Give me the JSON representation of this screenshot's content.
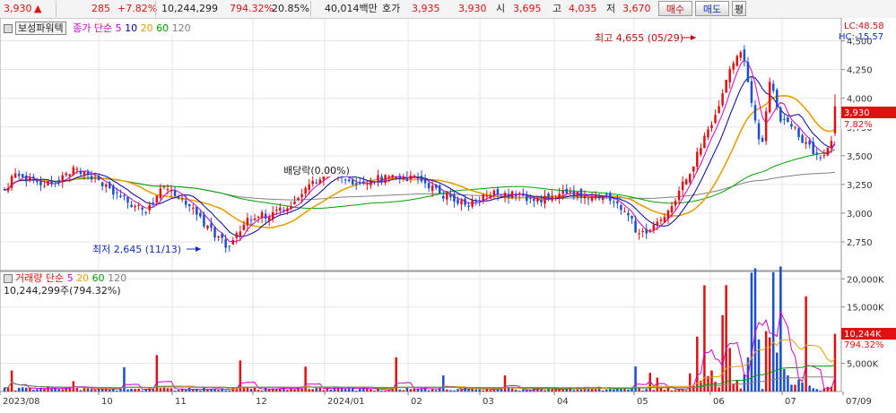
{
  "topbar": {
    "price": "3,930",
    "change_arrow": "▲",
    "change": "285",
    "change_pct": "+7.82%",
    "volume": "10,244,299",
    "volume_ratio": "794.32%",
    "turnover": "20.85%",
    "amount": "40,014백만",
    "quote_label": "호가",
    "ask": "3,935",
    "bid": "3,930",
    "open_label": "시",
    "open": "3,695",
    "high_label": "고",
    "high": "4,035",
    "low_label": "저",
    "low": "3,670",
    "buy_button": "매수",
    "sell_button": "매도",
    "eval_button": "평"
  },
  "price_panel": {
    "legend_name": "보성파워텍",
    "legend_ma_title": "종가 단순",
    "legend_ma_periods": [
      "5",
      "10",
      "20",
      "60",
      "120"
    ],
    "lc_label": "LC:48.58",
    "hc_label": "HC:-15.57",
    "high_annotation": "최고 4,655 (05/29)",
    "low_annotation": "최저 2,645 (11/13)",
    "dividend_annotation": "배당락(0.00%)",
    "last_price_tag": "3,930",
    "last_pct_tag": "7.82%"
  },
  "volume_panel": {
    "legend_title": "거래량 단순",
    "legend_ma_periods": [
      "5",
      "20",
      "60",
      "120"
    ],
    "current_value": "10,244,299주(794.32%)",
    "last_vol_tag": "10,244K",
    "last_pct_tag": "794.32%"
  },
  "colors": {
    "up": "#e01010",
    "down": "#1a4fd0",
    "ma5": "#d000d0",
    "ma10": "#0000a0",
    "ma20": "#e8a000",
    "ma60": "#00a000",
    "ma120": "#808080",
    "grid": "#e6e6e6"
  },
  "chart_data": {
    "type": "candlestick",
    "date_labels": [
      "2023/08",
      "10",
      "11",
      "12",
      "2024/01",
      "02",
      "03",
      "04",
      "05",
      "06",
      "07",
      "07/09"
    ],
    "price_axis": {
      "ylim": [
        2500,
        4700
      ],
      "ticks": [
        2750,
        3000,
        3250,
        3500,
        3750,
        4000,
        4250,
        4500
      ]
    },
    "volume_axis": {
      "ylim": [
        0,
        21000
      ],
      "ticks": [
        5000,
        10000,
        15000,
        20000
      ],
      "tick_labels": [
        "5,000K",
        "10,000K",
        "15,000K",
        "20,000K"
      ]
    },
    "extremes": {
      "high": 4655,
      "high_date": "05/29",
      "low": 2645,
      "low_date": "11/13"
    },
    "last": {
      "open": 3695,
      "high": 4035,
      "low": 3670,
      "close": 3930,
      "volume_k": 10244
    },
    "close_path": [
      [
        0,
        3190
      ],
      [
        5,
        3350
      ],
      [
        12,
        3280
      ],
      [
        20,
        3250
      ],
      [
        30,
        3380
      ],
      [
        40,
        3280
      ],
      [
        50,
        3150
      ],
      [
        60,
        3010
      ],
      [
        70,
        3250
      ],
      [
        80,
        3050
      ],
      [
        90,
        2830
      ],
      [
        97,
        2700
      ],
      [
        105,
        2950
      ],
      [
        115,
        3000
      ],
      [
        125,
        3100
      ],
      [
        135,
        3300
      ],
      [
        140,
        3400
      ],
      [
        150,
        3260
      ],
      [
        160,
        3300
      ],
      [
        170,
        3320
      ],
      [
        180,
        3290
      ],
      [
        190,
        3150
      ],
      [
        200,
        3070
      ],
      [
        210,
        3180
      ],
      [
        220,
        3160
      ],
      [
        230,
        3120
      ],
      [
        240,
        3170
      ],
      [
        250,
        3160
      ],
      [
        260,
        3150
      ],
      [
        268,
        3020
      ],
      [
        273,
        2820
      ],
      [
        280,
        2870
      ],
      [
        290,
        3150
      ],
      [
        300,
        3560
      ],
      [
        308,
        3930
      ],
      [
        313,
        4250
      ],
      [
        318,
        4400
      ],
      [
        322,
        3980
      ],
      [
        326,
        3530
      ],
      [
        330,
        4150
      ],
      [
        335,
        3800
      ],
      [
        340,
        3770
      ],
      [
        345,
        3600
      ],
      [
        350,
        3520
      ],
      [
        354,
        3500
      ],
      [
        357,
        3650
      ],
      [
        358,
        3930
      ]
    ]
  }
}
